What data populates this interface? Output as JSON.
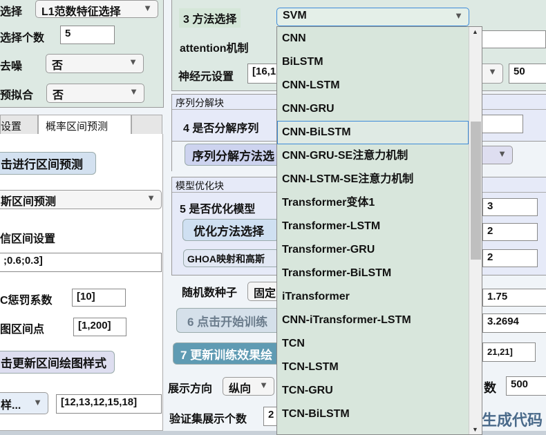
{
  "left": {
    "feature_method_label": "选择",
    "feature_method": "L1范数特征选择",
    "feature_count_label": "选择个数",
    "feature_count": "5",
    "denoise_label": "去噪",
    "denoise": "否",
    "overfit_label": "预拟合",
    "overfit": "否",
    "tabs": [
      {
        "label": "设置"
      },
      {
        "label": "概率区间预测"
      }
    ],
    "interval_button": "击进行区间预测",
    "interval_method": "斯区间预测",
    "confidence_label": "信区间设置",
    "confidence_value": ";0.6;0.3]",
    "penalty_label": "C惩罚系数",
    "penalty_value": "[10]",
    "plot_points_label": "图区间点",
    "plot_points_value": "[1,200]",
    "update_style_button": "击更新区间绘图样式",
    "style_select": "样...",
    "style_value": "[12,13,12,15,18]"
  },
  "middle": {
    "method_label": "3 方法选择",
    "method_selected": "SVM",
    "attention_label": "attention机制",
    "neurons_label": "神经元设置",
    "neurons_value": "[16,1",
    "decomp_panel": "序列分解块",
    "decomp_label": "4 是否分解序列",
    "decomp_button": "序列分解方法选",
    "opt_panel": "模型优化块",
    "opt_label": "5 是否优化模型",
    "opt_button": "优化方法选择",
    "opt_method": "GHOA映射和高斯",
    "seed_label": "随机数种子",
    "seed_value": "固定",
    "train_button": "6 点击开始训练",
    "update_button": "7 更新训练效果绘",
    "direction_label": "展示方向",
    "direction_value": "纵向",
    "val_count_label": "验证集展示个数",
    "val_count_value": "2"
  },
  "right": {
    "epochs_value": "50",
    "opt_v1": "3",
    "opt_v2": "2",
    "opt_v3": "2",
    "metric1": "1.75",
    "metric2": "3.2694",
    "range_value": "21,21]",
    "count_label": "数",
    "count_value": "500",
    "gen_code": "生成代码"
  },
  "dropdown_options": [
    "CNN",
    "BiLSTM",
    "CNN-LSTM",
    "CNN-GRU",
    "CNN-BiLSTM",
    "CNN-GRU-SE注意力机制",
    "CNN-LSTM-SE注意力机制",
    "Transformer变体1",
    "Transformer-LSTM",
    "Transformer-GRU",
    "Transformer-BiLSTM",
    "iTransformer",
    "CNN-iTransformer-LSTM",
    "TCN",
    "TCN-LSTM",
    "TCN-GRU",
    "TCN-BiLSTM"
  ],
  "colors": {
    "green_panel": "#dde9e3",
    "lavender_panel": "#e6eaf8",
    "highlight": "#3c8ad8",
    "teal_button": "#5f9bb3"
  }
}
